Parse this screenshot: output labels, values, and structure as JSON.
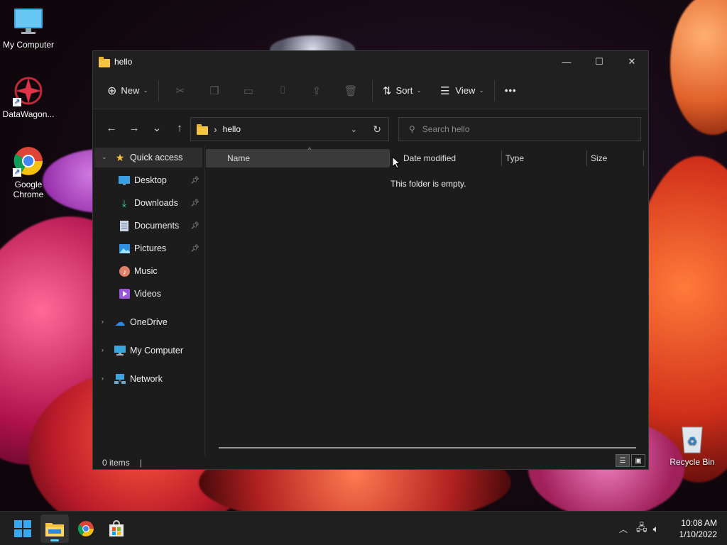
{
  "desktop": {
    "icons": [
      {
        "label": "My Computer",
        "icon": "monitor-icon"
      },
      {
        "label": "DataWagon...",
        "icon": "datawagon-logo-icon"
      },
      {
        "label": "Google Chrome",
        "icon": "chrome-icon"
      },
      {
        "label": "Recycle Bin",
        "icon": "recycle-bin-icon"
      }
    ]
  },
  "window": {
    "title": "hello",
    "controls": {
      "minimize": "—",
      "maximize": "☐",
      "close": "✕"
    }
  },
  "toolbar": {
    "new_label": "New",
    "sort_label": "Sort",
    "view_label": "View",
    "more_label": "•••"
  },
  "navigation": {
    "back": "←",
    "forward": "→",
    "recent": "⌄",
    "up": "↑",
    "address_separator": "›",
    "address_path": "hello",
    "search_placeholder": "Search hello"
  },
  "sidebar": {
    "quick_access": "Quick access",
    "items": [
      {
        "label": "Desktop",
        "pinned": true,
        "icon": "desktop-icon"
      },
      {
        "label": "Downloads",
        "pinned": true,
        "icon": "download-icon"
      },
      {
        "label": "Documents",
        "pinned": true,
        "icon": "document-icon"
      },
      {
        "label": "Pictures",
        "pinned": true,
        "icon": "picture-icon"
      },
      {
        "label": "Music",
        "pinned": false,
        "icon": "music-icon"
      },
      {
        "label": "Videos",
        "pinned": false,
        "icon": "video-icon"
      }
    ],
    "roots": [
      {
        "label": "OneDrive",
        "icon": "cloud-icon"
      },
      {
        "label": "My Computer",
        "icon": "monitor-icon"
      },
      {
        "label": "Network",
        "icon": "network-icon"
      }
    ]
  },
  "columns": [
    "Name",
    "Date modified",
    "Type",
    "Size"
  ],
  "empty_message": "This folder is empty.",
  "status": {
    "items": "0 items",
    "cursor": "|"
  },
  "taskbar": {
    "apps": [
      "start-icon",
      "file-explorer-icon",
      "chrome-icon",
      "store-icon"
    ],
    "time": "10:08 AM",
    "date": "1/10/2022"
  },
  "colors": {
    "accent": "#60cdff",
    "folder": "#f5c542",
    "window_bg": "#1c1c1c"
  }
}
